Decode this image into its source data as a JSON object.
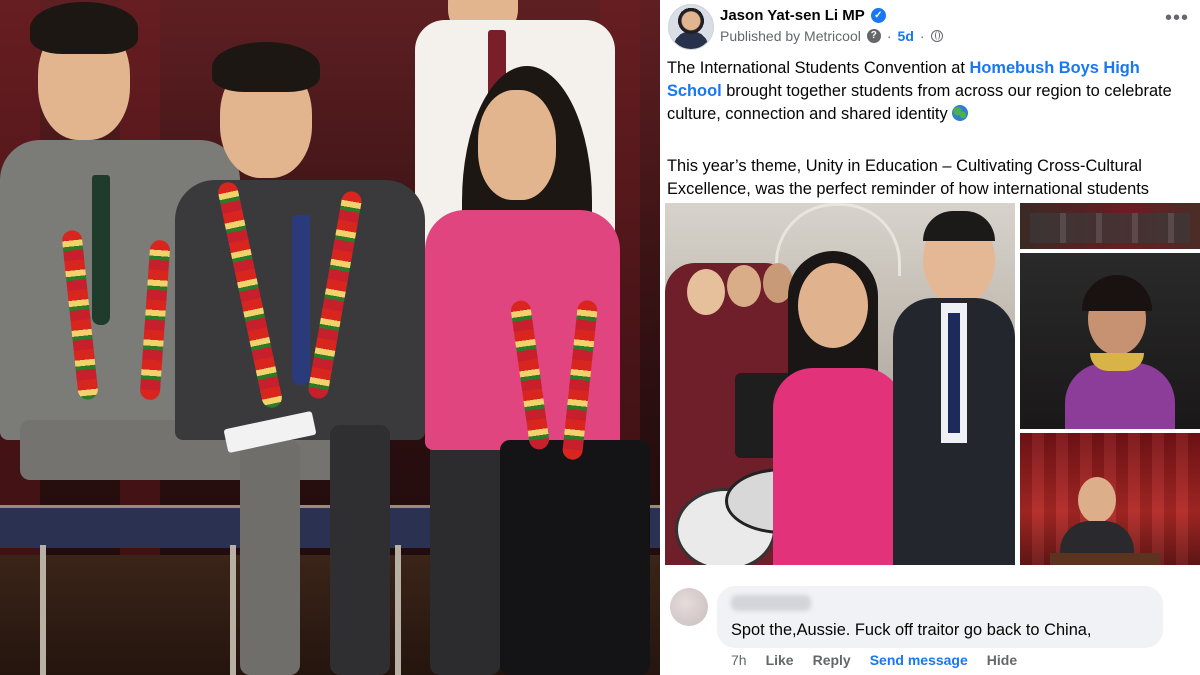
{
  "post": {
    "author": "Jason Yat-sen Li MP",
    "published_by": "Published by Metricool",
    "time": "5d",
    "paragraph1": {
      "before": "The International Students Convention at ",
      "link": "Homebush Boys High School",
      "after": " brought together students from across our region to celebrate culture, connection and shared identity "
    },
    "paragraph2": "This year’s theme, Unity in Education – Cultivating Cross-Cultural Excellence, was the perfect reminder of how international students enrich our schools and our wider community."
  },
  "comment": {
    "text": "Spot the,Aussie. Fuck off traitor go back to China,",
    "time": "7h",
    "like": "Like",
    "reply": "Reply",
    "send_message": "Send message",
    "hide": "Hide"
  },
  "icons": {
    "verified": "verified-badge-icon",
    "help": "question-icon",
    "audience": "globe-icon",
    "more": "more-options-icon",
    "emoji": "earth-globe-emoji"
  },
  "colors": {
    "link": "#1877f2",
    "text": "#050505",
    "secondary": "#65676b",
    "bubble": "#f0f2f5"
  }
}
